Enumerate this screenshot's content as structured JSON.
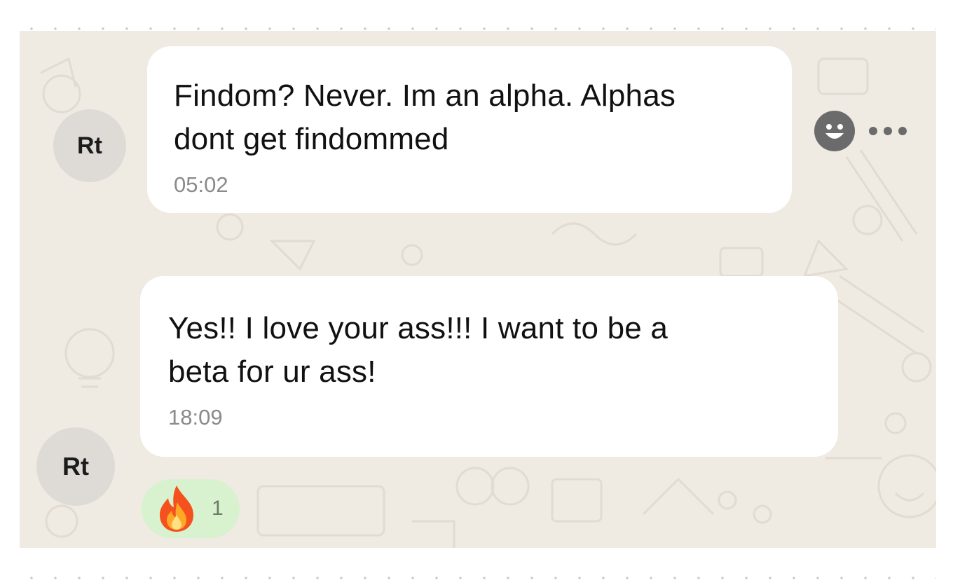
{
  "messages": [
    {
      "avatar_initials": "Rt",
      "text_line1": "Findom? Never. Im an alpha. Alphas",
      "text_line2": "dont get findommed",
      "time": "05:02"
    },
    {
      "avatar_initials": "Rt",
      "text_line1": "Yes!! I love your ass!!! I want to be a",
      "text_line2": "beta for ur ass!",
      "time": "18:09"
    }
  ],
  "actions": {
    "react_icon": "smiley-icon",
    "more_icon": "more-options-icon"
  },
  "reaction": {
    "emoji_icon": "fire-icon",
    "count": "1"
  },
  "colors": {
    "chat_background": "#efeae2",
    "bubble": "#ffffff",
    "reaction_pill": "#d8f2cf",
    "avatar": "#dedbd7"
  }
}
